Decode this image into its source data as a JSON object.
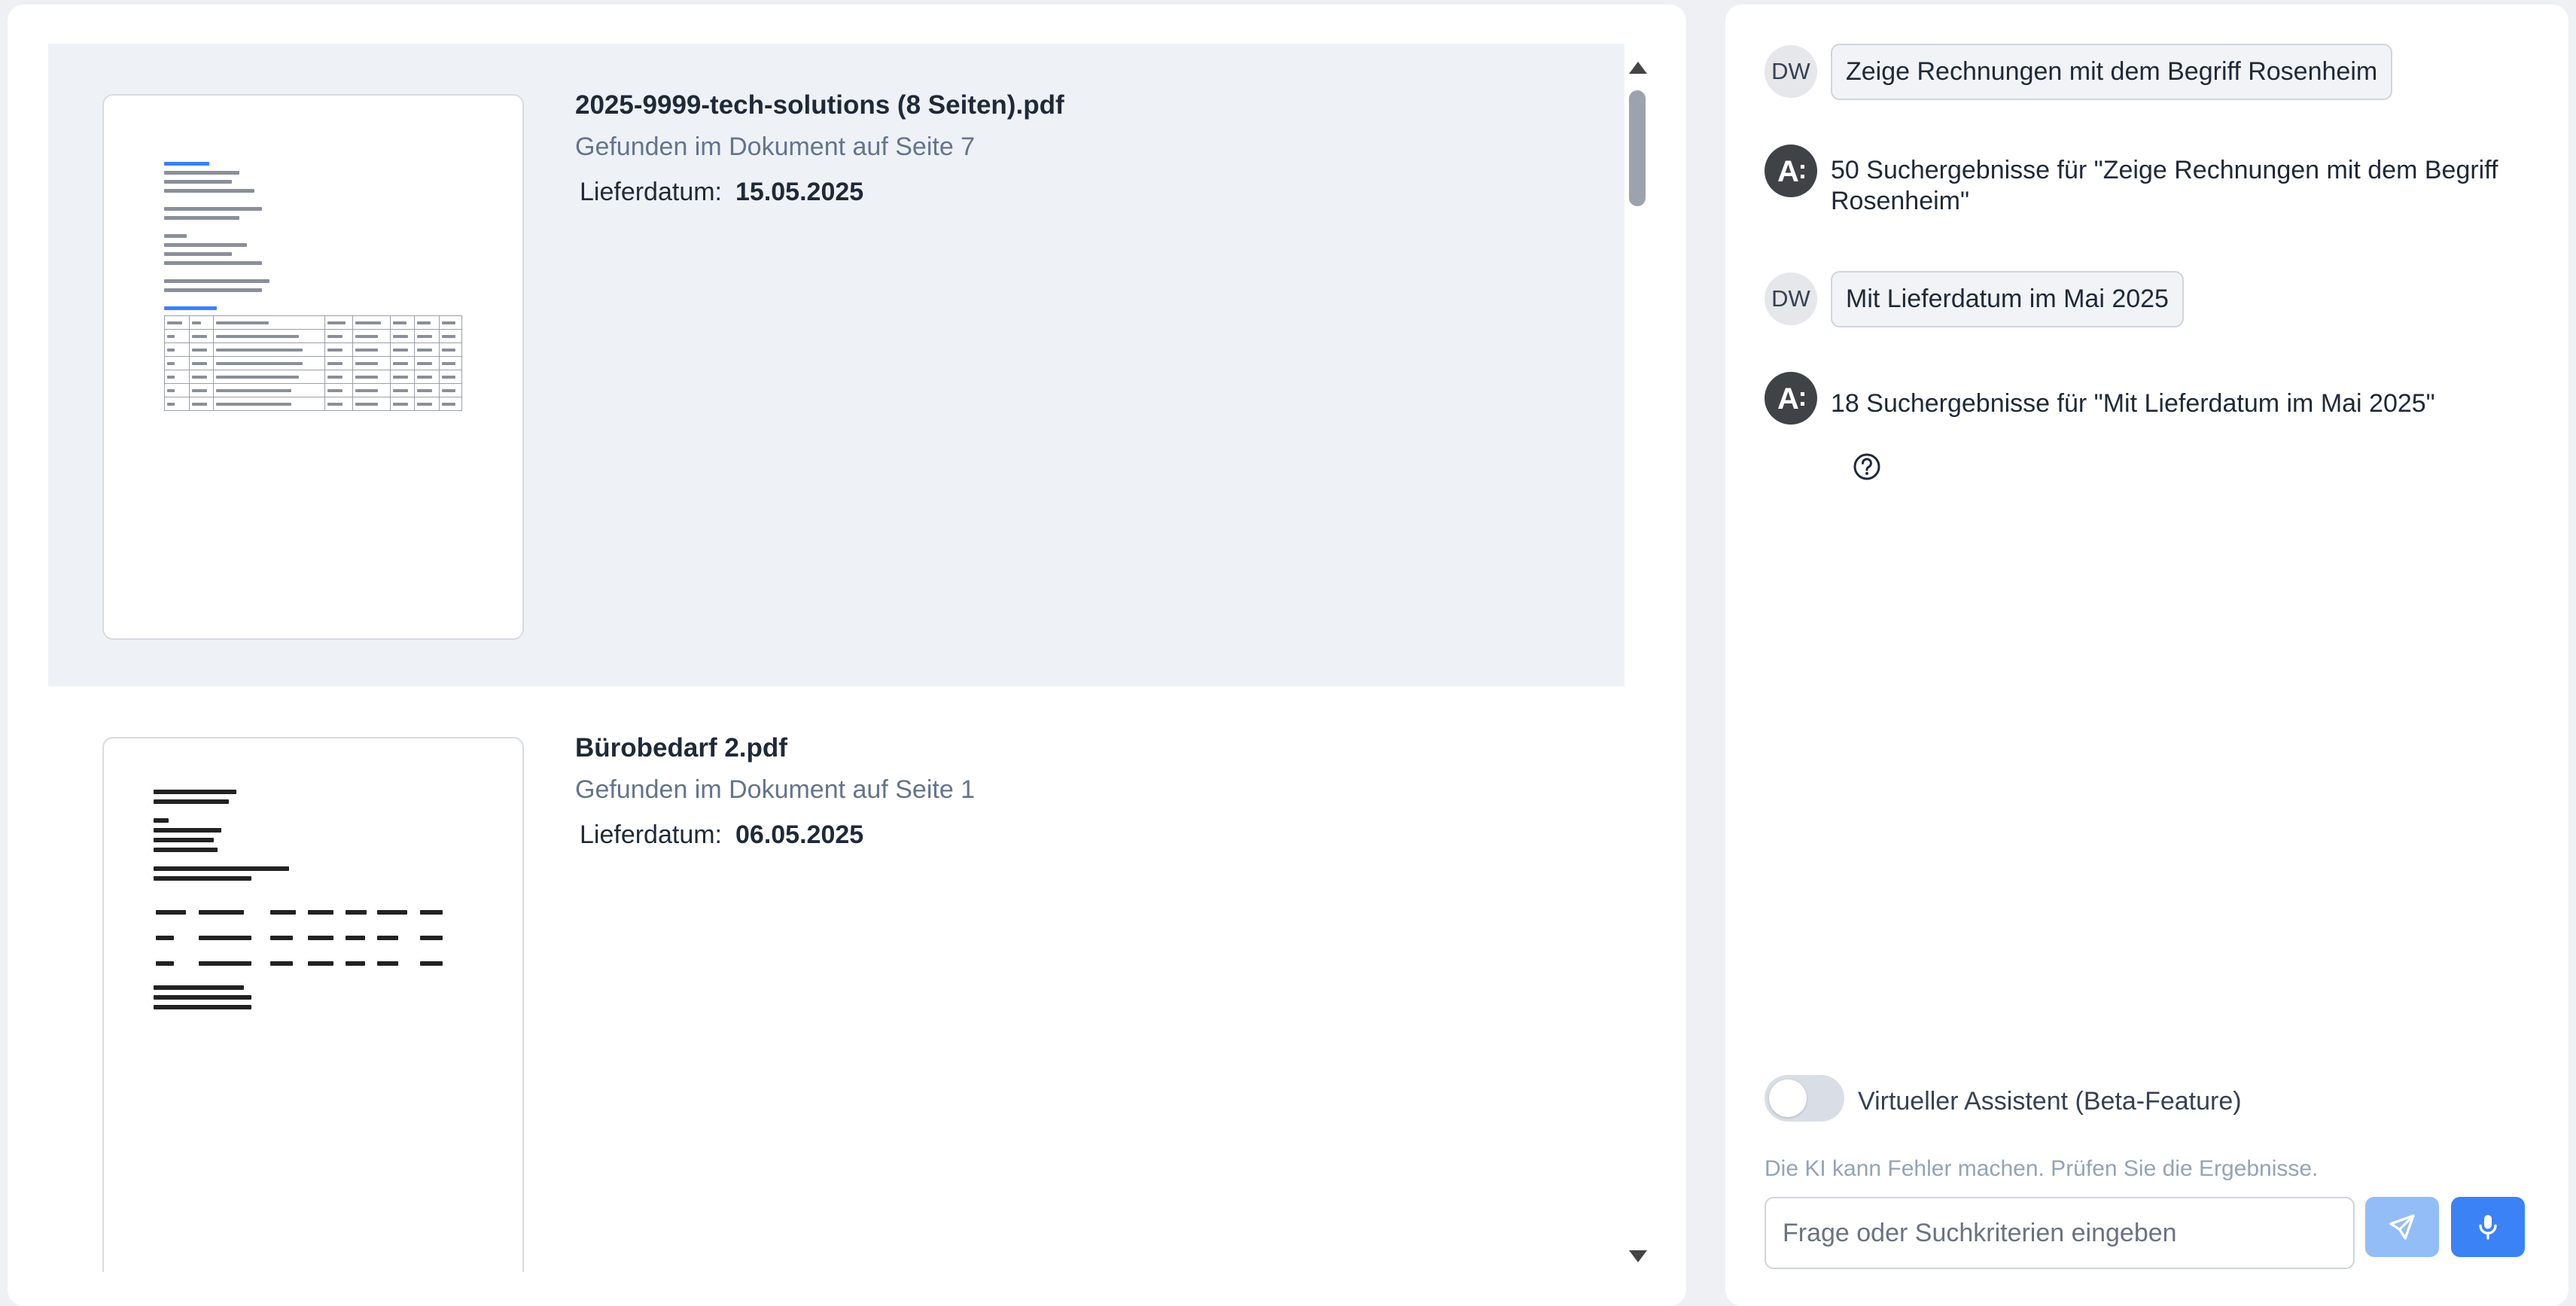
{
  "results": {
    "items": [
      {
        "title": "2025-9999-tech-solutions (8 Seiten).pdf",
        "found": "Gefunden im Dokument auf Seite 7",
        "date_label": "Lieferdatum:",
        "date_value": "15.05.2025",
        "selected": true
      },
      {
        "title": "Bürobedarf 2.pdf",
        "found": "Gefunden im Dokument auf Seite 1",
        "date_label": "Lieferdatum:",
        "date_value": "06.05.2025",
        "selected": false
      }
    ]
  },
  "chat": {
    "messages": [
      {
        "role": "user",
        "avatar": "DW",
        "text": "Zeige Rechnungen mit dem Begriff Rosenheim"
      },
      {
        "role": "assistant",
        "text": "50 Suchergebnisse für \"Zeige Rechnungen mit dem Begriff Rosenheim\""
      },
      {
        "role": "user",
        "avatar": "DW",
        "text": "Mit Lieferdatum im Mai 2025"
      },
      {
        "role": "assistant",
        "text": "18 Suchergebnisse für \"Mit Lieferdatum im Mai 2025\""
      }
    ],
    "assistant_toggle_label": "Virtueller Assistent (Beta-Feature)",
    "assistant_toggle_on": false,
    "disclaimer": "Die KI kann Fehler machen. Prüfen Sie die Ergebnisse.",
    "input_placeholder": "Frage oder Suchkriterien eingeben",
    "input_value": ""
  },
  "colors": {
    "accent": "#3b82f6",
    "accent_light": "#93bdf6",
    "selected_row": "#eef2f7",
    "muted_text": "#64748b"
  },
  "icons": [
    "help-icon",
    "send-icon",
    "microphone-icon",
    "assistant-logo-icon",
    "scroll-up-icon",
    "scroll-down-icon"
  ]
}
